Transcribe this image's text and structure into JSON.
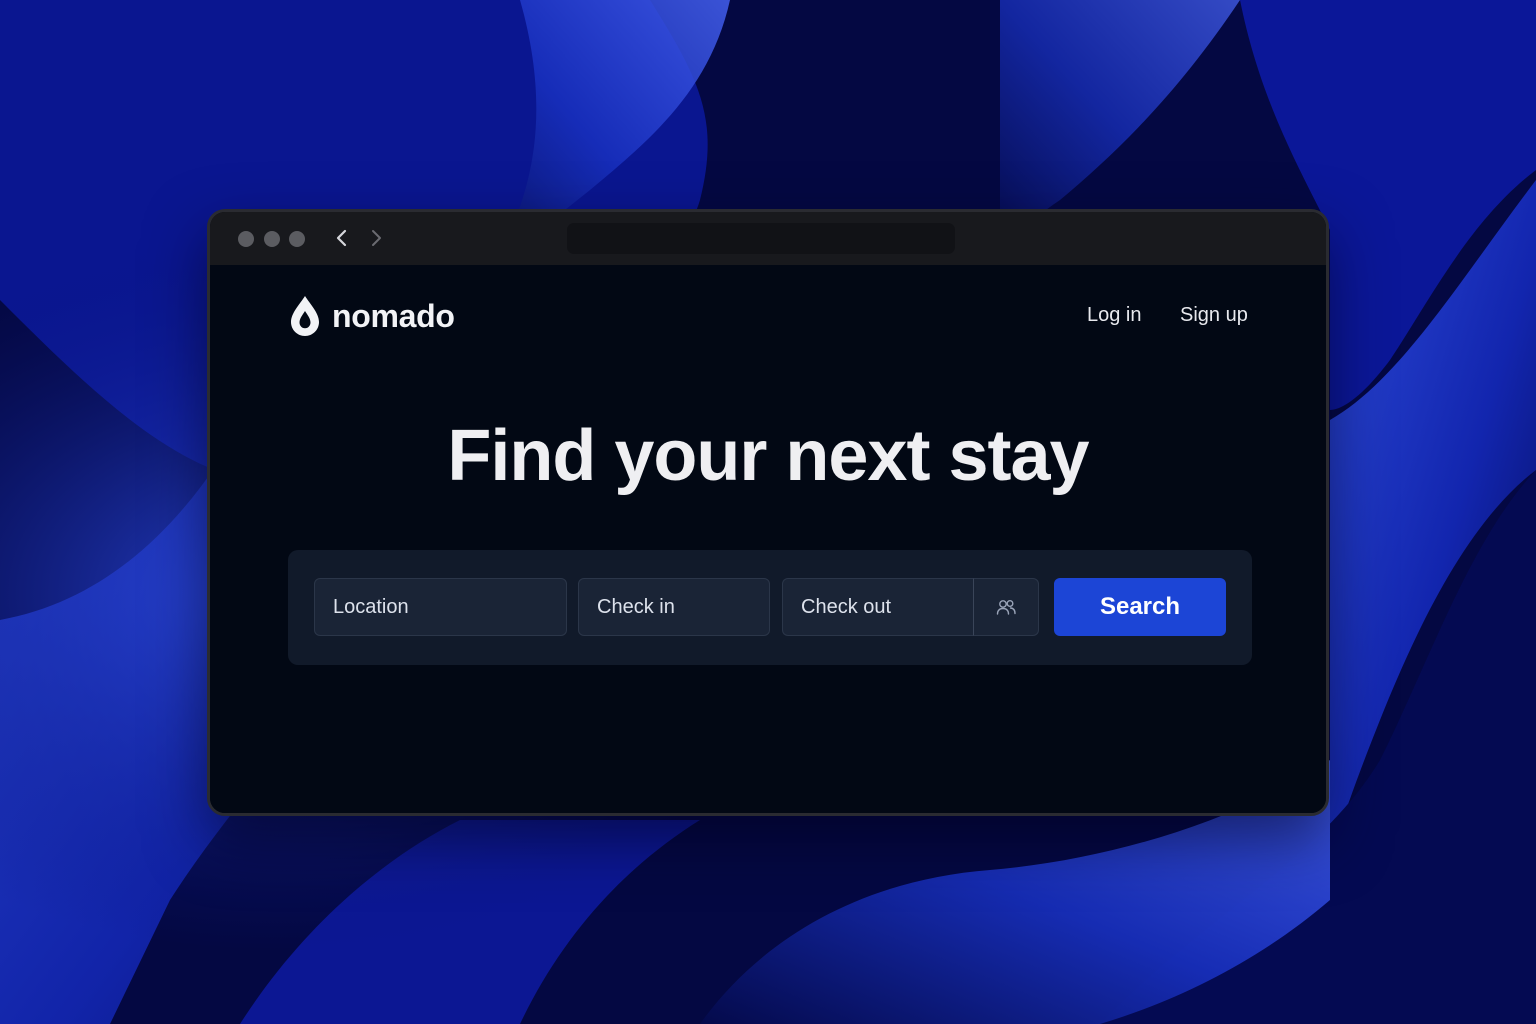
{
  "window": {
    "titlebar": {
      "back_icon": "chevron-left-icon",
      "forward_icon": "chevron-right-icon"
    }
  },
  "brand": {
    "icon": "droplet-icon",
    "name": "nomado"
  },
  "header": {
    "login_label": "Log in",
    "signup_label": "Sign up"
  },
  "hero": {
    "title": "Find your next stay"
  },
  "search": {
    "location_placeholder": "Location",
    "checkin_placeholder": "Check in",
    "checkout_placeholder": "Check out",
    "guests_icon": "guests-icon",
    "button_label": "Search"
  },
  "colors": {
    "background": "#050a45",
    "window": "#020814",
    "panel": "#111a2a",
    "field": "#1a2436",
    "accent": "#1c45d6",
    "text": "#efeff2"
  }
}
